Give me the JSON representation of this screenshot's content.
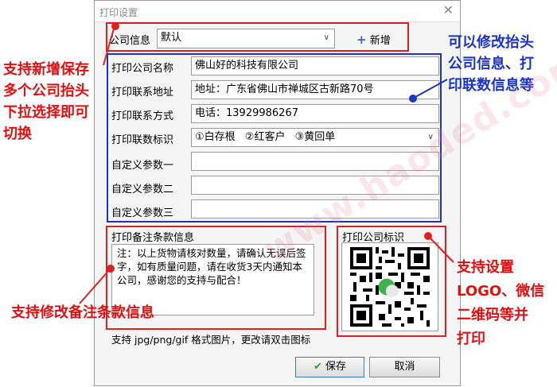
{
  "dialog": {
    "title": "打印设置",
    "close_glyph": "✕"
  },
  "company": {
    "label": "公司信息",
    "selected": "默认",
    "add_label": "新增"
  },
  "fields": [
    {
      "label": "打印公司名称",
      "value": "佛山好的科技有限公司"
    },
    {
      "label": "打印联系地址",
      "value": "地址：广东省佛山市禅城区古新路70号"
    },
    {
      "label": "打印联系方式",
      "value": "电话：13929986267"
    },
    {
      "label": "打印联数标识",
      "value": ""
    },
    {
      "label": "自定义参数一",
      "value": ""
    },
    {
      "label": "自定义参数二",
      "value": ""
    },
    {
      "label": "自定义参数三",
      "value": ""
    }
  ],
  "copies": [
    "①白存根",
    "②红客户",
    "③黄回单"
  ],
  "remarks": {
    "label": "打印备注条款信息",
    "text": "注：以上货物请核对数量，请确认无误后签字，如有质量问题，请在收货3天内通知本公司，感谢您的支持与配合！"
  },
  "logo": {
    "label": "打印公司标识",
    "hint": "支持 jpg/png/gif 格式图片，更改请双击图标"
  },
  "buttons": {
    "save": "保存",
    "cancel": "取消"
  },
  "annotations": {
    "left_top": [
      "支持新增保存",
      "多个公司抬头",
      "下拉选择即可",
      "切换"
    ],
    "right_top": [
      "可以修改抬头",
      "公司信息、打",
      "印联数信息等"
    ],
    "left_bottom": "支持修改备注条款信息",
    "right_bottom": [
      "支持设置",
      "LOGO、微信",
      "二维码等并",
      "打印"
    ]
  },
  "watermark": "www.haoded.com",
  "colors": {
    "red": "#e02020",
    "blue": "#1a34c8",
    "save_check": "#3a9a3a"
  }
}
